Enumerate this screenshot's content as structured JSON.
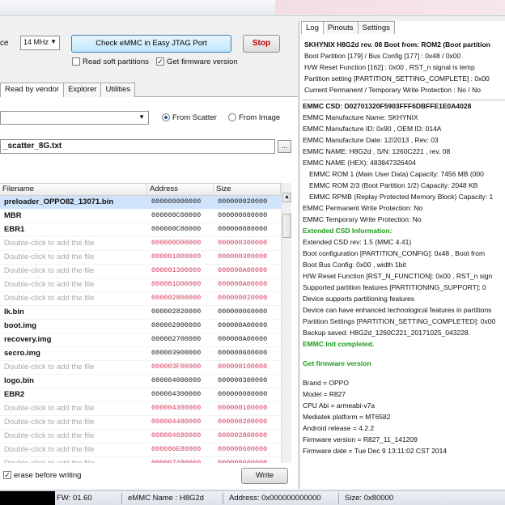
{
  "toolbar": {
    "clock_label_partial": "ce",
    "clock_value": "14 MHz",
    "check_button": "Check eMMC in Easy JTAG Port",
    "stop_button": "Stop",
    "read_soft_partitions": "Read soft partitions",
    "get_firmware_version": "Get firmware version",
    "get_firmware_checked": true,
    "read_soft_checked": false
  },
  "left_tabs": [
    "Read by vendor",
    "Explorer",
    "Utilities"
  ],
  "source": {
    "from_scatter": "From Scatter",
    "from_image": "From Image",
    "selected": "From Scatter",
    "scatter_file": "_scatter_8G.txt",
    "browse": "..."
  },
  "table": {
    "headers": [
      "Filename",
      "Address",
      "Size"
    ],
    "rows": [
      {
        "name": "preloader_OPPO82_13071.bin",
        "address": "000000000000",
        "size": "000000020000",
        "placeholder": false,
        "selected": true
      },
      {
        "name": "MBR",
        "address": "000000C00000",
        "size": "000000080000",
        "placeholder": false
      },
      {
        "name": "EBR1",
        "address": "000000C80000",
        "size": "000000080000",
        "placeholder": false
      },
      {
        "name": "Double-click to add the file",
        "address": "000000D00000",
        "size": "000000300000",
        "placeholder": true
      },
      {
        "name": "Double-click to add the file",
        "address": "000001000000",
        "size": "000000300000",
        "placeholder": true
      },
      {
        "name": "Double-click to add the file",
        "address": "000001300000",
        "size": "000000A00000",
        "placeholder": true
      },
      {
        "name": "Double-click to add the file",
        "address": "000001D00000",
        "size": "000000A00000",
        "placeholder": true
      },
      {
        "name": "Double-click to add the file",
        "address": "000002800000",
        "size": "000000020000",
        "placeholder": true
      },
      {
        "name": "lk.bin",
        "address": "000002820000",
        "size": "000000060000",
        "placeholder": false
      },
      {
        "name": "boot.img",
        "address": "000002900000",
        "size": "000000A00000",
        "placeholder": false
      },
      {
        "name": "recovery.img",
        "address": "000002700000",
        "size": "000000A00000",
        "placeholder": false
      },
      {
        "name": "secro.img",
        "address": "000003900000",
        "size": "000000600000",
        "placeholder": false
      },
      {
        "name": "Double-click to add the file",
        "address": "000003F00000",
        "size": "000000100000",
        "placeholder": true
      },
      {
        "name": "logo.bin",
        "address": "000004000000",
        "size": "000000300000",
        "placeholder": false
      },
      {
        "name": "EBR2",
        "address": "000004300000",
        "size": "000000080000",
        "placeholder": false
      },
      {
        "name": "Double-click to add the file",
        "address": "000004380000",
        "size": "000000100000",
        "placeholder": true
      },
      {
        "name": "Double-click to add the file",
        "address": "000004480000",
        "size": "000000200000",
        "placeholder": true
      },
      {
        "name": "Double-click to add the file",
        "address": "000004680000",
        "size": "000002800000",
        "placeholder": true
      },
      {
        "name": "Double-click to add the file",
        "address": "000006E80000",
        "size": "000000600000",
        "placeholder": true
      },
      {
        "name": "Double-click to add the file",
        "address": "000007480000",
        "size": "000000600000",
        "placeholder": true
      }
    ]
  },
  "bottom": {
    "erase_before_writing": "erase before writing",
    "erase_checked": true,
    "write_button": "Write"
  },
  "right_tabs": [
    "Log",
    "Pinouts",
    "Settings"
  ],
  "log_top": [
    {
      "t": "SKHYNIX  H8G2d  rev. 08   Boot from: ROM2 (Boot partition",
      "s": "b"
    },
    {
      "t": "Boot Partition [179] / Bus Config [177] : 0x48 / 0x00",
      "s": ""
    },
    {
      "t": "H/W Reset Function [162] : 0x00 , RST_n signal is temp",
      "s": ""
    },
    {
      "t": "Partition setting [PARTITION_SETTING_COMPLETE] : 0x00",
      "s": ""
    },
    {
      "t": "Current Permanent / Temporary Write Protection : No / No",
      "s": ""
    }
  ],
  "log_main": [
    {
      "t": "EMMC CSD: D02701320F5903FFF6DBFFE1E0A4028",
      "s": "b"
    },
    {
      "t": "EMMC Manufacture Name: SKHYNIX",
      "s": ""
    },
    {
      "t": "EMMC Manufacture ID: 0x90 , OEM ID: 014A",
      "s": ""
    },
    {
      "t": "EMMC Manufacture Date: 12/2013 , Rev: 03",
      "s": ""
    },
    {
      "t": "EMMC NAME: H8G2d , S/N: 1260C221 , rev. 08",
      "s": ""
    },
    {
      "t": "EMMC NAME (HEX): 483847326404",
      "s": ""
    },
    {
      "t": "EMMC ROM 1 (Main User Data) Capacity: 7456 MB (000",
      "s": "ind"
    },
    {
      "t": "EMMC ROM 2/3 (Boot Partition 1/2) Capacity: 2048 KB",
      "s": "ind"
    },
    {
      "t": "EMMC RPMB (Replay Protected Memory Block) Capacity: 1",
      "s": "ind"
    },
    {
      "t": "EMMC Permanent Write Protection: No",
      "s": ""
    },
    {
      "t": "EMMC Temporary Write Protection: No",
      "s": ""
    },
    {
      "t": "Extended CSD Information:",
      "s": "g"
    },
    {
      "t": "Extended CSD rev: 1.5 (MMC 4.41)",
      "s": ""
    },
    {
      "t": "Boot configuration [PARTITION_CONFIG]: 0x48 , Boot from",
      "s": ""
    },
    {
      "t": "Boot Bus Config: 0x00 , width 1bit",
      "s": ""
    },
    {
      "t": "H/W Reset Function [RST_N_FUNCTION]: 0x00 , RST_n sign",
      "s": ""
    },
    {
      "t": "Supported partition features [PARTITIONING_SUPPORT]: 0",
      "s": ""
    },
    {
      "t": "Device supports partitioning features",
      "s": ""
    },
    {
      "t": "Device can have enhanced technological features in partitions",
      "s": ""
    },
    {
      "t": "Partition Settings [PARTITION_SETTING_COMPLETED]: 0x00",
      "s": ""
    },
    {
      "t": "Backup saved: H8G2d_1260C221_20171025_043228.",
      "s": ""
    },
    {
      "t": "EMMC Init completed.",
      "s": "g"
    },
    {
      "t": "",
      "s": "space"
    },
    {
      "t": "Get firmware version",
      "s": "g"
    },
    {
      "t": "",
      "s": "space"
    },
    {
      "t": "Brand = OPPO",
      "s": ""
    },
    {
      "t": "Model = R827",
      "s": ""
    },
    {
      "t": "CPU Abi = armeabi-v7a",
      "s": ""
    },
    {
      "t": "Mediatek platform = MT6582",
      "s": ""
    },
    {
      "t": "Android release = 4.2.2",
      "s": ""
    },
    {
      "t": "Firmware version = R827_11_141209",
      "s": ""
    },
    {
      "t": "Firmware date = Tue Dec 9 13:11:02 CST 2014",
      "s": ""
    }
  ],
  "statusbar": {
    "fw": "FW: 01.60",
    "emmc_name": "eMMC Name : H8G2d",
    "address": "Address: 0x000000000000",
    "size": "Size: 0x80000"
  }
}
